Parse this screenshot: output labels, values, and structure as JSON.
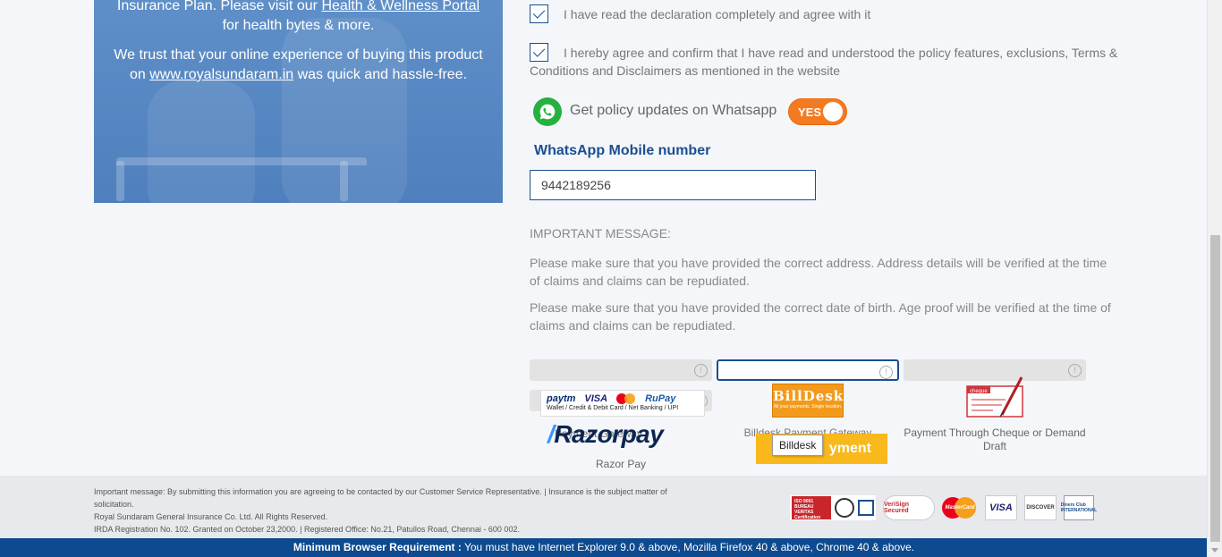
{
  "promo": {
    "line1_prefix": "Insurance Plan. Please visit our ",
    "line1_link": "Health & Wellness Portal",
    "line1_suffix": " for health bytes & more.",
    "line2_prefix": "We trust that your online experience of buying this product on ",
    "line2_link": "www.royalsundaram.in",
    "line2_suffix": " was quick and hassle-free."
  },
  "declarations": {
    "read_declaration": "I have read the declaration completely and agree with it",
    "agree_policy": "I hereby agree and confirm that I have read and understood the policy features, exclusions, Terms & Conditions and Disclaimers as mentioned in the website"
  },
  "whatsapp": {
    "label": "Get policy updates on Whatsapp",
    "toggle_label": "YES",
    "mobile_label": "WhatsApp Mobile number",
    "mobile_value": "9442189256"
  },
  "important": {
    "title": "IMPORTANT MESSAGE:",
    "msg1": "Please make sure that you have provided the correct address. Address details will be verified at the time of claims and claims can be repudiated.",
    "msg2": "Please make sure that you have provided the correct date of birth. Age proof will be verified at the time of claims and claims can be repudiated."
  },
  "payment": {
    "paytm_row1": [
      "paytm",
      "VISA",
      "RuPay"
    ],
    "paytm_row2": "Wallet / Credit & Debit Card / Net Banking / UPI",
    "hidden_caption": "Payment Gateway",
    "razorpay_logo": "Razorpay",
    "razorpay_caption": "Razor Pay",
    "billdesk_logo": "BillDesk",
    "billdesk_tagline": "All your payments. Single location.",
    "billdesk_caption": "Billdesk Payment Gateway",
    "pay_button": "yment",
    "tooltip": "Billdesk",
    "cheque_caption": "Payment Through Cheque or Demand Draft",
    "cheque_icon_text": "cheque"
  },
  "footer": {
    "line1": "Important message: By submitting this information you are agreeing to be contacted by our Customer Service Representative. | Insurance is the subject matter of solicitation.",
    "line2": "Royal Sundaram General Insurance Co. Ltd. All Rights Reserved.",
    "line3": "IRDA Registration No. 102. Granted on October 23,2000. | Registered Office: No.21, Patullos Road, Chennai - 600 002.",
    "badges": {
      "bureau_veritas": "ISO 9001 BUREAU VERITAS Certification",
      "verisign": "VeriSign Secured",
      "mastercard": "MasterCard",
      "visa": "VISA",
      "discover": "DISCOVER",
      "diners": "Diners Club INTERNATIONAL"
    }
  },
  "requirement": {
    "label": "Minimum Browser Requirement :",
    "text": " You must have Internet Explorer 9.0 & above, Mozilla Firefox 40 & above, Chrome 40 & above."
  },
  "colors": {
    "brand_blue": "#1c4f8f",
    "toggle_orange": "#f47a20",
    "whatsapp_green": "#25b13d",
    "pay_yellow": "#f9b81b"
  }
}
